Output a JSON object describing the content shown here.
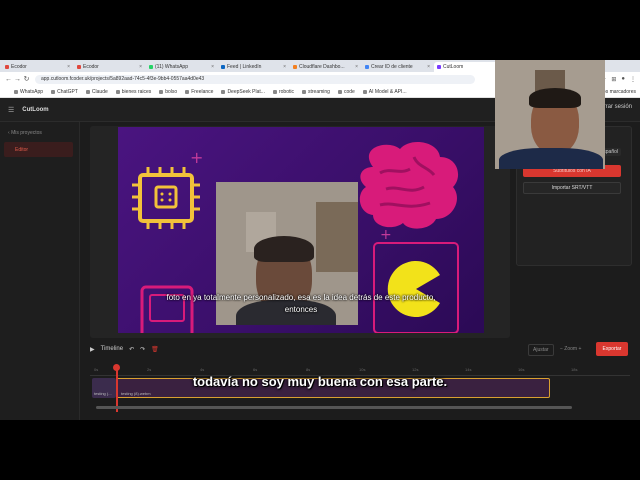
{
  "browser": {
    "tabs": [
      {
        "label": "Ecodor",
        "color": "#e0483e",
        "active": false
      },
      {
        "label": "Ecodor",
        "color": "#e0483e",
        "active": false
      },
      {
        "label": "(11) WhatsApp",
        "color": "#25d366",
        "active": false
      },
      {
        "label": "Feed | LinkedIn",
        "color": "#0a66c2",
        "active": false
      },
      {
        "label": "Cloudflare Dashbo...",
        "color": "#f38020",
        "active": false
      },
      {
        "label": "Crear ID de cliente",
        "color": "#4285f4",
        "active": false
      },
      {
        "label": "CutLoom",
        "color": "#7a3cff",
        "active": true
      }
    ],
    "url": "app.cutloom.fcoder.uk/projects/5a892aad-74c5-4f3e-9bb4-0557aa4d0e43",
    "bookmarks": [
      "WhatsApp",
      "ChatGPT",
      "Claude",
      "bienes raices",
      "bolso",
      "Freelance",
      "DeepSeek Plat...",
      "robotic",
      "streaming",
      "code",
      "AI Model & API..."
    ],
    "all_bookmarks": "Todos los marcadores"
  },
  "app": {
    "brand": "CutLoom",
    "logout": "Cerrar sesión",
    "back_link": "Mis proyectos",
    "side_editor": "Editor",
    "lang": "Español",
    "ai_button": "Subtítulos con IA",
    "srt_button": "Importar SRT/VTT",
    "timeline_label": "Timeline",
    "fit": "Ajustar",
    "zoom": "− Zoom +",
    "export": "Exportar",
    "ruler_ticks": [
      "0s",
      "2s",
      "4s",
      "6s",
      "8s",
      "10s",
      "12s",
      "14s",
      "16s",
      "18s"
    ],
    "clip_labels": [
      "testing (...",
      "testing (8).webm"
    ]
  },
  "subtitles": {
    "preview_line1": "foto en ya totalmente personalizado, esa es la idea detrás de este producto,",
    "preview_line2": "entonces",
    "caption": "todavía no soy muy buena con esa parte."
  }
}
